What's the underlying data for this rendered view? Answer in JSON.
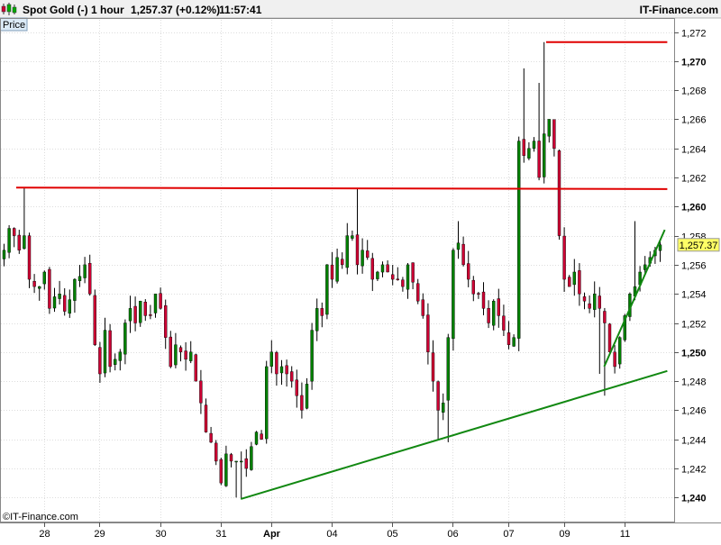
{
  "header": {
    "symbol": "Spot Gold (-)",
    "timeframe": "1 hour",
    "quote": "1,257.37 (+0.12%)",
    "time": "11:57:41",
    "brand": "IT-Finance.com"
  },
  "price_tab_label": "Price",
  "watermark": "©IT-Finance.com",
  "colors": {
    "up": "#008000",
    "down": "#cc0033",
    "wick": "#000000",
    "resistance": "#e00000",
    "support": "#118811",
    "price_label_bg": "#ffff66"
  },
  "chart_data": {
    "type": "candlestick",
    "title": "Spot Gold (-) 1 hour",
    "ylim": [
      1239,
      1273
    ],
    "y_ticks": [
      {
        "v": 1240,
        "label": "1,240",
        "major": true
      },
      {
        "v": 1242,
        "label": "1,242",
        "major": false
      },
      {
        "v": 1244,
        "label": "1,244",
        "major": false
      },
      {
        "v": 1246,
        "label": "1,246",
        "major": false
      },
      {
        "v": 1248,
        "label": "1,248",
        "major": false
      },
      {
        "v": 1250,
        "label": "1,250",
        "major": true
      },
      {
        "v": 1252,
        "label": "1,252",
        "major": false
      },
      {
        "v": 1254,
        "label": "1,254",
        "major": false
      },
      {
        "v": 1256,
        "label": "1,256",
        "major": false
      },
      {
        "v": 1258,
        "label": "1,258",
        "major": false
      },
      {
        "v": 1260,
        "label": "1,260",
        "major": true
      },
      {
        "v": 1262,
        "label": "1,262",
        "major": false
      },
      {
        "v": 1264,
        "label": "1,264",
        "major": false
      },
      {
        "v": 1266,
        "label": "1,266",
        "major": false
      },
      {
        "v": 1268,
        "label": "1,268",
        "major": false
      },
      {
        "v": 1270,
        "label": "1,270",
        "major": true
      },
      {
        "v": 1272,
        "label": "1,272",
        "major": false
      }
    ],
    "x_ticks": [
      {
        "bar": 8,
        "label": "28",
        "bold": false
      },
      {
        "bar": 19,
        "label": "29",
        "bold": false
      },
      {
        "bar": 31,
        "label": "30",
        "bold": false
      },
      {
        "bar": 43,
        "label": "31",
        "bold": false
      },
      {
        "bar": 53,
        "label": "Apr",
        "bold": true
      },
      {
        "bar": 65,
        "label": "04",
        "bold": false
      },
      {
        "bar": 77,
        "label": "05",
        "bold": false
      },
      {
        "bar": 89,
        "label": "06",
        "bold": false
      },
      {
        "bar": 100,
        "label": "07",
        "bold": false
      },
      {
        "bar": 111,
        "label": "09",
        "bold": false
      },
      {
        "bar": 123,
        "label": "11",
        "bold": false
      }
    ],
    "last_price": 1257.37,
    "last_price_label": "1,257.37",
    "bars_count": 131,
    "closes": [
      1257.0,
      1258.5,
      1258.0,
      1257.0,
      1258.0,
      1255.0,
      1254.5,
      1254.5,
      1255.5,
      1253.0,
      1253.8,
      1254.0,
      1252.8,
      1253.6,
      1255.0,
      1255.2,
      1256.0,
      1254.0,
      1250.5,
      1248.5,
      1251.5,
      1249.0,
      1249.5,
      1250.0,
      1252.0,
      1253.0,
      1252.0,
      1253.5,
      1252.5,
      1252.5,
      1254.0,
      1253.0,
      1251.0,
      1249.0,
      1250.5,
      1250.0,
      1249.5,
      1250.0,
      1248.0,
      1246.5,
      1244.5,
      1243.8,
      1242.5,
      1241.0,
      1243.0,
      1242.5,
      1242.5,
      1242.5,
      1242.0,
      1243.5,
      1244.5,
      1244.0,
      1249.0,
      1250.0,
      1248.5,
      1249.0,
      1248.5,
      1248.0,
      1247.0,
      1246.0,
      1247.8,
      1251.5,
      1253.0,
      1252.5,
      1256.0,
      1255.0,
      1256.5,
      1256.0,
      1258.0,
      1258.0,
      1256.0,
      1257.0,
      1256.5,
      1255.0,
      1255.5,
      1256.0,
      1255.5,
      1255.0,
      1255.0,
      1254.5,
      1256.0,
      1254.8,
      1253.5,
      1252.5,
      1250.0,
      1248.0,
      1246.0,
      1246.5,
      1251.0,
      1257.0,
      1257.5,
      1256.0,
      1255.0,
      1254.0,
      1254.0,
      1253.0,
      1252.0,
      1253.5,
      1252.5,
      1251.5,
      1250.5,
      1251.0,
      1264.5,
      1263.5,
      1264.0,
      1264.5,
      1262.0,
      1265.0,
      1266.0,
      1264.0,
      1258.0,
      1255.0,
      1254.5,
      1255.5,
      1254.0,
      1253.5,
      1253.0,
      1254.0,
      1253.0,
      1252.0,
      1250.0,
      1249.0,
      1251.0,
      1252.5,
      1254.0,
      1254.5,
      1255.5,
      1256.0,
      1256.5,
      1257.0,
      1257.37
    ],
    "annotations": [
      {
        "kind": "resistance_line",
        "color": "red",
        "from": {
          "bar": 2.5,
          "price": 1261.3
        },
        "to": {
          "bar": 131.5,
          "price": 1261.2
        }
      },
      {
        "kind": "resistance_line",
        "color": "red",
        "from": {
          "bar": 107.5,
          "price": 1271.3
        },
        "to": {
          "bar": 131.5,
          "price": 1271.3
        }
      },
      {
        "kind": "support_line",
        "color": "green",
        "from": {
          "bar": 47,
          "price": 1239.9
        },
        "to": {
          "bar": 131.5,
          "price": 1248.7
        }
      },
      {
        "kind": "support_line",
        "color": "green",
        "from": {
          "bar": 119,
          "price": 1249.0
        },
        "to": {
          "bar": 131,
          "price": 1258.4
        }
      }
    ]
  }
}
